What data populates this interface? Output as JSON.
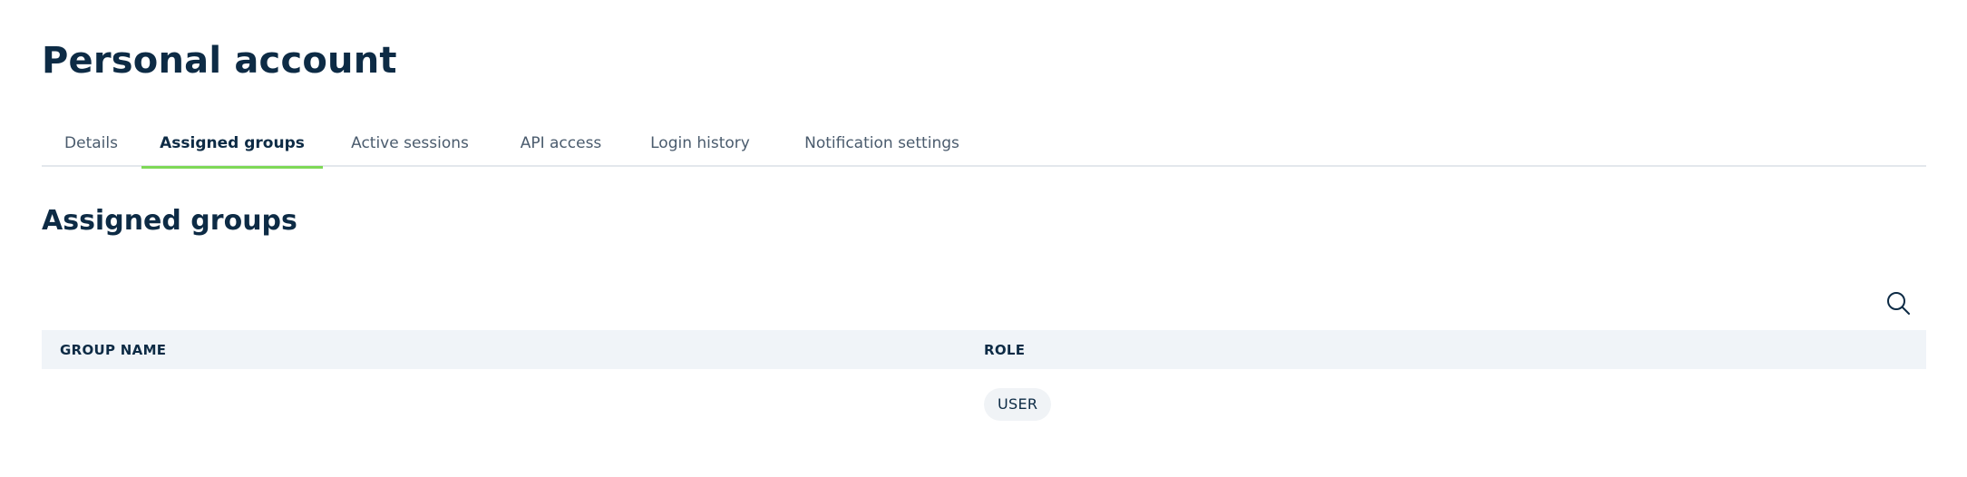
{
  "page": {
    "title": "Personal account"
  },
  "tabs": [
    {
      "label": "Details",
      "active": false
    },
    {
      "label": "Assigned groups",
      "active": true
    },
    {
      "label": "Active sessions",
      "active": false
    },
    {
      "label": "API access",
      "active": false
    },
    {
      "label": "Login history",
      "active": false
    },
    {
      "label": "Notification settings",
      "active": false
    }
  ],
  "section": {
    "title": "Assigned groups"
  },
  "search": {
    "icon": "search-icon"
  },
  "table": {
    "columns": {
      "group_name": "GROUP NAME",
      "role": "ROLE"
    },
    "rows": [
      {
        "group_name": "",
        "role": "USER"
      }
    ]
  },
  "colors": {
    "primary_text": "#0d2b45",
    "tab_inactive": "#4a5b6d",
    "tab_active_underline": "#7ed957",
    "header_background": "#f0f4f8",
    "badge_background": "#f0f3f6",
    "divider": "#e3e7ec"
  }
}
